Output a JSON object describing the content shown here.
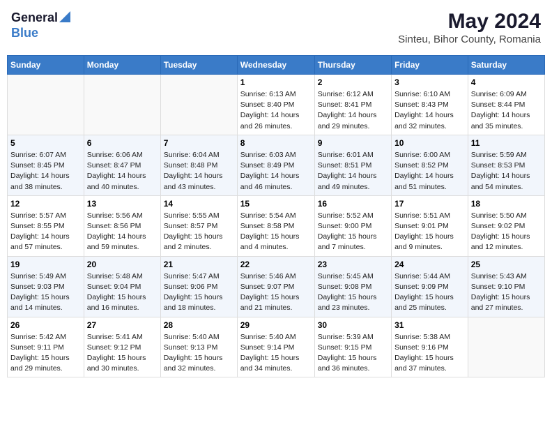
{
  "header": {
    "logo_general": "General",
    "logo_blue": "Blue",
    "month_year": "May 2024",
    "location": "Sinteu, Bihor County, Romania"
  },
  "days_of_week": [
    "Sunday",
    "Monday",
    "Tuesday",
    "Wednesday",
    "Thursday",
    "Friday",
    "Saturday"
  ],
  "weeks": [
    [
      {
        "day": "",
        "info": ""
      },
      {
        "day": "",
        "info": ""
      },
      {
        "day": "",
        "info": ""
      },
      {
        "day": "1",
        "info": "Sunrise: 6:13 AM\nSunset: 8:40 PM\nDaylight: 14 hours and 26 minutes."
      },
      {
        "day": "2",
        "info": "Sunrise: 6:12 AM\nSunset: 8:41 PM\nDaylight: 14 hours and 29 minutes."
      },
      {
        "day": "3",
        "info": "Sunrise: 6:10 AM\nSunset: 8:43 PM\nDaylight: 14 hours and 32 minutes."
      },
      {
        "day": "4",
        "info": "Sunrise: 6:09 AM\nSunset: 8:44 PM\nDaylight: 14 hours and 35 minutes."
      }
    ],
    [
      {
        "day": "5",
        "info": "Sunrise: 6:07 AM\nSunset: 8:45 PM\nDaylight: 14 hours and 38 minutes."
      },
      {
        "day": "6",
        "info": "Sunrise: 6:06 AM\nSunset: 8:47 PM\nDaylight: 14 hours and 40 minutes."
      },
      {
        "day": "7",
        "info": "Sunrise: 6:04 AM\nSunset: 8:48 PM\nDaylight: 14 hours and 43 minutes."
      },
      {
        "day": "8",
        "info": "Sunrise: 6:03 AM\nSunset: 8:49 PM\nDaylight: 14 hours and 46 minutes."
      },
      {
        "day": "9",
        "info": "Sunrise: 6:01 AM\nSunset: 8:51 PM\nDaylight: 14 hours and 49 minutes."
      },
      {
        "day": "10",
        "info": "Sunrise: 6:00 AM\nSunset: 8:52 PM\nDaylight: 14 hours and 51 minutes."
      },
      {
        "day": "11",
        "info": "Sunrise: 5:59 AM\nSunset: 8:53 PM\nDaylight: 14 hours and 54 minutes."
      }
    ],
    [
      {
        "day": "12",
        "info": "Sunrise: 5:57 AM\nSunset: 8:55 PM\nDaylight: 14 hours and 57 minutes."
      },
      {
        "day": "13",
        "info": "Sunrise: 5:56 AM\nSunset: 8:56 PM\nDaylight: 14 hours and 59 minutes."
      },
      {
        "day": "14",
        "info": "Sunrise: 5:55 AM\nSunset: 8:57 PM\nDaylight: 15 hours and 2 minutes."
      },
      {
        "day": "15",
        "info": "Sunrise: 5:54 AM\nSunset: 8:58 PM\nDaylight: 15 hours and 4 minutes."
      },
      {
        "day": "16",
        "info": "Sunrise: 5:52 AM\nSunset: 9:00 PM\nDaylight: 15 hours and 7 minutes."
      },
      {
        "day": "17",
        "info": "Sunrise: 5:51 AM\nSunset: 9:01 PM\nDaylight: 15 hours and 9 minutes."
      },
      {
        "day": "18",
        "info": "Sunrise: 5:50 AM\nSunset: 9:02 PM\nDaylight: 15 hours and 12 minutes."
      }
    ],
    [
      {
        "day": "19",
        "info": "Sunrise: 5:49 AM\nSunset: 9:03 PM\nDaylight: 15 hours and 14 minutes."
      },
      {
        "day": "20",
        "info": "Sunrise: 5:48 AM\nSunset: 9:04 PM\nDaylight: 15 hours and 16 minutes."
      },
      {
        "day": "21",
        "info": "Sunrise: 5:47 AM\nSunset: 9:06 PM\nDaylight: 15 hours and 18 minutes."
      },
      {
        "day": "22",
        "info": "Sunrise: 5:46 AM\nSunset: 9:07 PM\nDaylight: 15 hours and 21 minutes."
      },
      {
        "day": "23",
        "info": "Sunrise: 5:45 AM\nSunset: 9:08 PM\nDaylight: 15 hours and 23 minutes."
      },
      {
        "day": "24",
        "info": "Sunrise: 5:44 AM\nSunset: 9:09 PM\nDaylight: 15 hours and 25 minutes."
      },
      {
        "day": "25",
        "info": "Sunrise: 5:43 AM\nSunset: 9:10 PM\nDaylight: 15 hours and 27 minutes."
      }
    ],
    [
      {
        "day": "26",
        "info": "Sunrise: 5:42 AM\nSunset: 9:11 PM\nDaylight: 15 hours and 29 minutes."
      },
      {
        "day": "27",
        "info": "Sunrise: 5:41 AM\nSunset: 9:12 PM\nDaylight: 15 hours and 30 minutes."
      },
      {
        "day": "28",
        "info": "Sunrise: 5:40 AM\nSunset: 9:13 PM\nDaylight: 15 hours and 32 minutes."
      },
      {
        "day": "29",
        "info": "Sunrise: 5:40 AM\nSunset: 9:14 PM\nDaylight: 15 hours and 34 minutes."
      },
      {
        "day": "30",
        "info": "Sunrise: 5:39 AM\nSunset: 9:15 PM\nDaylight: 15 hours and 36 minutes."
      },
      {
        "day": "31",
        "info": "Sunrise: 5:38 AM\nSunset: 9:16 PM\nDaylight: 15 hours and 37 minutes."
      },
      {
        "day": "",
        "info": ""
      }
    ]
  ]
}
